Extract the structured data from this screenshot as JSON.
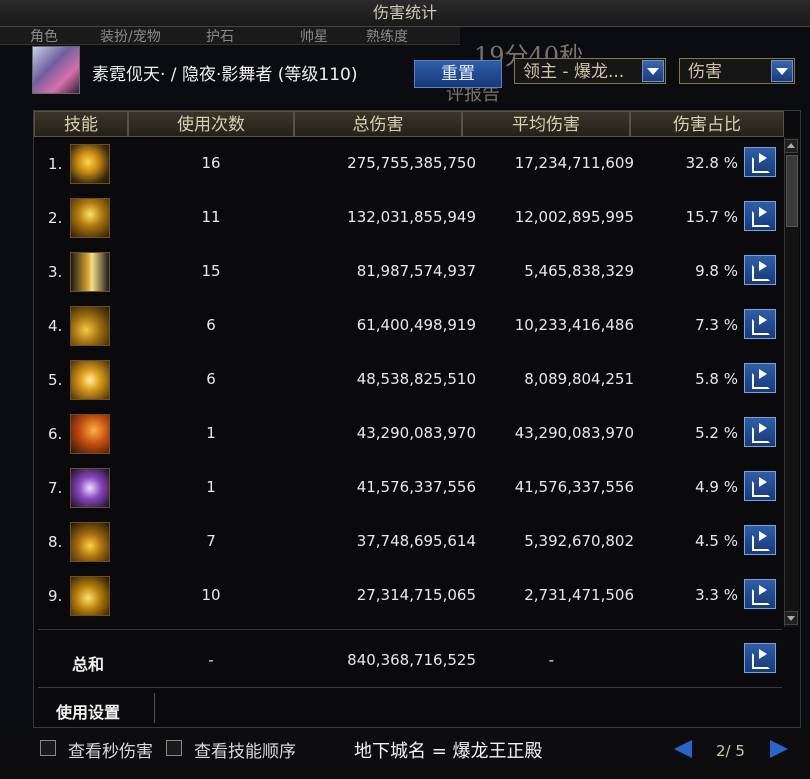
{
  "window": {
    "title": "伤害统计"
  },
  "background": {
    "tabs": [
      "角色",
      "装扮/宠物",
      "护石",
      "帅星",
      "熟练度"
    ],
    "timer": "19分40秒",
    "subtitle": "评报告"
  },
  "player": {
    "name_line": "素霓伣天· / 隐夜·影舞者 (等级110)"
  },
  "controls": {
    "reset_label": "重置",
    "boss_select": "领主 - 爆龙...",
    "type_select": "伤害"
  },
  "table": {
    "headers": [
      "技能",
      "使用次数",
      "总伤害",
      "平均伤害",
      "伤害占比"
    ],
    "rows": [
      {
        "index": "1.",
        "icon": "skill-icon-1",
        "uses": "16",
        "total": "275,755,385,750",
        "avg": "17,234,711,609",
        "pct": "32.8 %"
      },
      {
        "index": "2.",
        "icon": "skill-icon-2",
        "uses": "11",
        "total": "132,031,855,949",
        "avg": "12,002,895,995",
        "pct": "15.7 %"
      },
      {
        "index": "3.",
        "icon": "skill-icon-3",
        "uses": "15",
        "total": "81,987,574,937",
        "avg": "5,465,838,329",
        "pct": "9.8 %"
      },
      {
        "index": "4.",
        "icon": "skill-icon-4",
        "uses": "6",
        "total": "61,400,498,919",
        "avg": "10,233,416,486",
        "pct": "7.3 %"
      },
      {
        "index": "5.",
        "icon": "skill-icon-5",
        "uses": "6",
        "total": "48,538,825,510",
        "avg": "8,089,804,251",
        "pct": "5.8 %"
      },
      {
        "index": "6.",
        "icon": "skill-icon-6",
        "uses": "1",
        "total": "43,290,083,970",
        "avg": "43,290,083,970",
        "pct": "5.2 %"
      },
      {
        "index": "7.",
        "icon": "skill-icon-7",
        "uses": "1",
        "total": "41,576,337,556",
        "avg": "41,576,337,556",
        "pct": "4.9 %"
      },
      {
        "index": "8.",
        "icon": "skill-icon-8",
        "uses": "7",
        "total": "37,748,695,614",
        "avg": "5,392,670,802",
        "pct": "4.5 %"
      },
      {
        "index": "9.",
        "icon": "skill-icon-9",
        "uses": "10",
        "total": "27,314,715,065",
        "avg": "2,731,471,506",
        "pct": "3.3 %"
      }
    ],
    "total": {
      "label": "总和",
      "uses": "-",
      "total": "840,368,716,525",
      "avg": "-"
    }
  },
  "settings": {
    "label": "使用设置"
  },
  "bottom": {
    "check1": "查看秒伤害",
    "check2": "查看技能顺序",
    "dungeon": "地下城名 = 爆龙王正殿",
    "page": "2/ 5"
  },
  "colors": {
    "accent_blue": "#2a64c8",
    "header_gold": "#d8ceb0",
    "panel_bg": "#0b0c10"
  }
}
